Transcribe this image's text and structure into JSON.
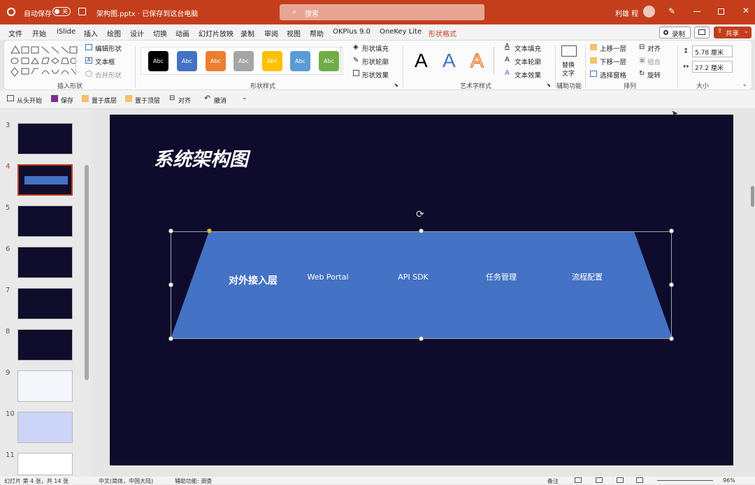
{
  "titlebar": {
    "autosave": "自动保存",
    "toggle": "关",
    "filename": "架构图.pptx · 已保存到这台电脑",
    "search_placeholder": "搜索",
    "user": "利雄 程"
  },
  "menu": [
    "文件",
    "开始",
    "iSlide",
    "插入",
    "绘图",
    "设计",
    "切换",
    "动画",
    "幻灯片放映",
    "录制",
    "审阅",
    "视图",
    "帮助",
    "OKPlus 9.0",
    "OneKey Lite",
    "形状格式"
  ],
  "menu_active": "形状格式",
  "menu_right": {
    "record": "录制",
    "share": "共享"
  },
  "ribbon": {
    "insert_shapes": {
      "edit_shape": "编辑形状",
      "textbox": "文本框",
      "merge_shapes": "合并形状",
      "label": "插入形状"
    },
    "shape_styles": {
      "swatches": [
        {
          "text": "Abc",
          "color": "#000000"
        },
        {
          "text": "Abc",
          "color": "#4472c4"
        },
        {
          "text": "Abc",
          "color": "#ed7d31"
        },
        {
          "text": "Abc",
          "color": "#a5a5a5"
        },
        {
          "text": "Abc",
          "color": "#ffc000"
        },
        {
          "text": "Abc",
          "color": "#5b9bd5"
        },
        {
          "text": "Abc",
          "color": "#70ad47"
        }
      ],
      "fill": "形状填充",
      "outline": "形状轮廓",
      "effects": "形状效果",
      "label": "形状样式"
    },
    "wordart": {
      "letter": "A",
      "text_fill": "文本填充",
      "text_outline": "文本轮廓",
      "text_effects": "文本效果",
      "label": "艺术字样式"
    },
    "accessibility": {
      "alt_text_1": "替换",
      "alt_text_2": "文字",
      "label": "辅助功能"
    },
    "arrange": {
      "bring_forward": "上移一层",
      "send_backward": "下移一层",
      "selection_pane": "选择窗格",
      "align": "对齐",
      "group": "组合",
      "rotate": "旋转",
      "label": "排列"
    },
    "size": {
      "height": "5.78 厘米",
      "width": "27.2 厘米",
      "label": "大小"
    }
  },
  "qat": [
    "从头开始",
    "保存",
    "置于底层",
    "置于顶层",
    "对齐",
    "撤消"
  ],
  "slides": [
    {
      "num": "3"
    },
    {
      "num": "4"
    },
    {
      "num": "5"
    },
    {
      "num": "6"
    },
    {
      "num": "7"
    },
    {
      "num": "8"
    },
    {
      "num": "9"
    },
    {
      "num": "10"
    },
    {
      "num": "11"
    }
  ],
  "slide": {
    "title": "系统架构图",
    "layer_label": "对外接入层",
    "items": [
      "Web Portal",
      "API SDK",
      "任务管理",
      "流程配置"
    ]
  },
  "status": {
    "slide_info": "幻灯片 第 4 张，共 14 张",
    "language": "中文(简体，中国大陆)",
    "accessibility": "辅助功能: 调查",
    "notes": "备注",
    "zoom": "96%"
  },
  "colors": {
    "accent": "#c43e1c",
    "slide_bg": "#0f0b2c",
    "trapezoid": "#4472c4"
  }
}
